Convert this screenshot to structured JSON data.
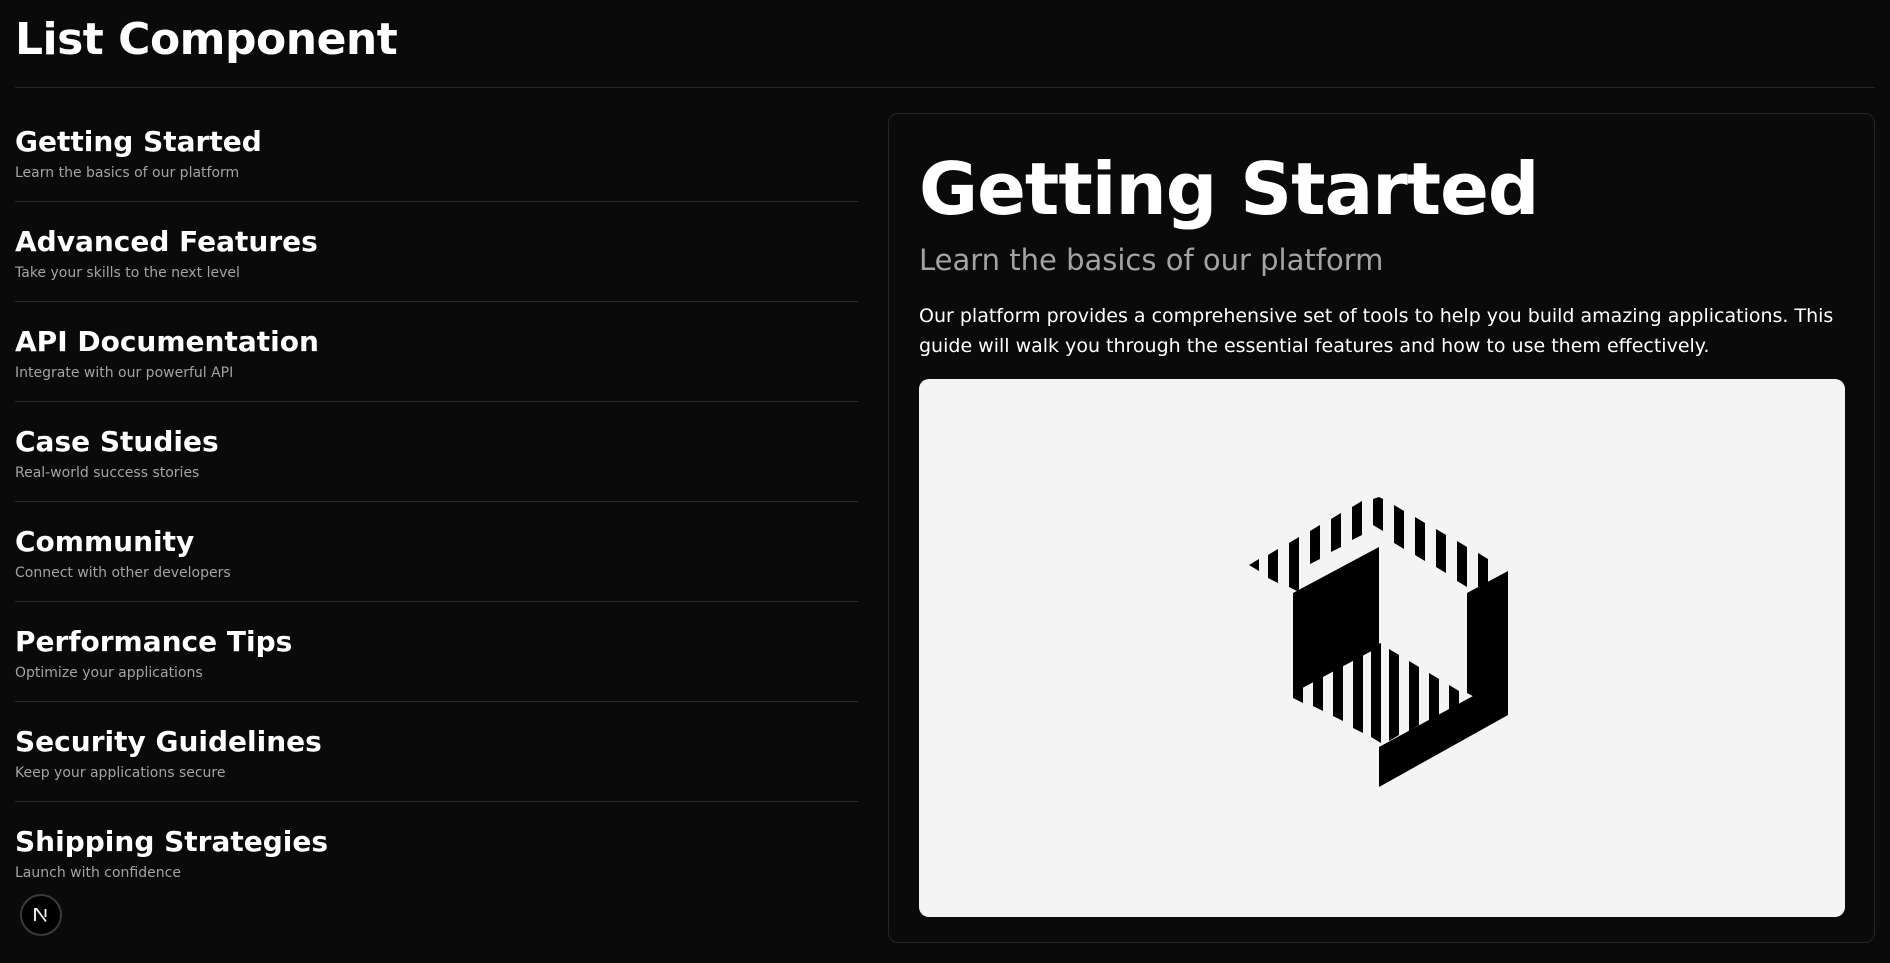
{
  "header": {
    "title": "List Component"
  },
  "list": {
    "items": [
      {
        "title": "Getting Started",
        "subtitle": "Learn the basics of our platform"
      },
      {
        "title": "Advanced Features",
        "subtitle": "Take your skills to the next level"
      },
      {
        "title": "API Documentation",
        "subtitle": "Integrate with our powerful API"
      },
      {
        "title": "Case Studies",
        "subtitle": "Real-world success stories"
      },
      {
        "title": "Community",
        "subtitle": "Connect with other developers"
      },
      {
        "title": "Performance Tips",
        "subtitle": "Optimize your applications"
      },
      {
        "title": "Security Guidelines",
        "subtitle": "Keep your applications secure"
      },
      {
        "title": "Shipping Strategies",
        "subtitle": "Launch with confidence"
      }
    ],
    "selected_index": 0
  },
  "detail": {
    "title": "Getting Started",
    "subtitle": "Learn the basics of our platform",
    "body": "Our platform provides a comprehensive set of tools to help you build amazing applications. This guide will walk you through the essential features and how to use them effectively.",
    "image_icon": "striped-cube-logo-icon"
  },
  "badge": {
    "icon": "nextjs-n-icon"
  },
  "colors": {
    "background": "#0a0a0a",
    "text_primary": "#ffffff",
    "text_secondary": "#a3a3a3",
    "divider": "#2a2a2a",
    "image_background": "#f4f4f4"
  }
}
